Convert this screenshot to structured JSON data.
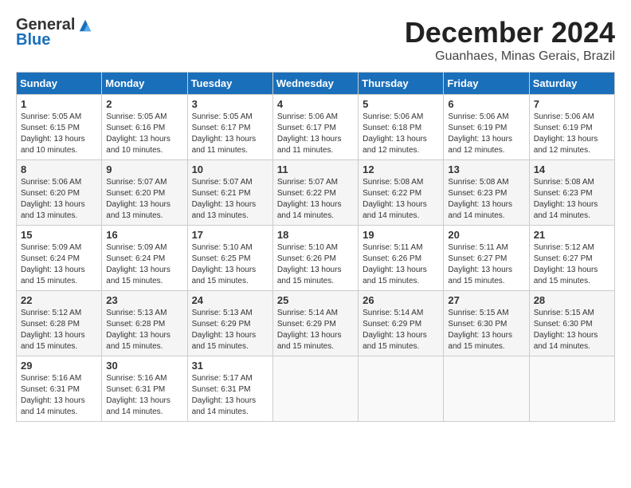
{
  "logo": {
    "general": "General",
    "blue": "Blue"
  },
  "title": "December 2024",
  "subtitle": "Guanhaes, Minas Gerais, Brazil",
  "headers": [
    "Sunday",
    "Monday",
    "Tuesday",
    "Wednesday",
    "Thursday",
    "Friday",
    "Saturday"
  ],
  "weeks": [
    [
      {
        "day": "1",
        "info": "Sunrise: 5:05 AM\nSunset: 6:15 PM\nDaylight: 13 hours\nand 10 minutes."
      },
      {
        "day": "2",
        "info": "Sunrise: 5:05 AM\nSunset: 6:16 PM\nDaylight: 13 hours\nand 10 minutes."
      },
      {
        "day": "3",
        "info": "Sunrise: 5:05 AM\nSunset: 6:17 PM\nDaylight: 13 hours\nand 11 minutes."
      },
      {
        "day": "4",
        "info": "Sunrise: 5:06 AM\nSunset: 6:17 PM\nDaylight: 13 hours\nand 11 minutes."
      },
      {
        "day": "5",
        "info": "Sunrise: 5:06 AM\nSunset: 6:18 PM\nDaylight: 13 hours\nand 12 minutes."
      },
      {
        "day": "6",
        "info": "Sunrise: 5:06 AM\nSunset: 6:19 PM\nDaylight: 13 hours\nand 12 minutes."
      },
      {
        "day": "7",
        "info": "Sunrise: 5:06 AM\nSunset: 6:19 PM\nDaylight: 13 hours\nand 12 minutes."
      }
    ],
    [
      {
        "day": "8",
        "info": "Sunrise: 5:06 AM\nSunset: 6:20 PM\nDaylight: 13 hours\nand 13 minutes."
      },
      {
        "day": "9",
        "info": "Sunrise: 5:07 AM\nSunset: 6:20 PM\nDaylight: 13 hours\nand 13 minutes."
      },
      {
        "day": "10",
        "info": "Sunrise: 5:07 AM\nSunset: 6:21 PM\nDaylight: 13 hours\nand 13 minutes."
      },
      {
        "day": "11",
        "info": "Sunrise: 5:07 AM\nSunset: 6:22 PM\nDaylight: 13 hours\nand 14 minutes."
      },
      {
        "day": "12",
        "info": "Sunrise: 5:08 AM\nSunset: 6:22 PM\nDaylight: 13 hours\nand 14 minutes."
      },
      {
        "day": "13",
        "info": "Sunrise: 5:08 AM\nSunset: 6:23 PM\nDaylight: 13 hours\nand 14 minutes."
      },
      {
        "day": "14",
        "info": "Sunrise: 5:08 AM\nSunset: 6:23 PM\nDaylight: 13 hours\nand 14 minutes."
      }
    ],
    [
      {
        "day": "15",
        "info": "Sunrise: 5:09 AM\nSunset: 6:24 PM\nDaylight: 13 hours\nand 15 minutes."
      },
      {
        "day": "16",
        "info": "Sunrise: 5:09 AM\nSunset: 6:24 PM\nDaylight: 13 hours\nand 15 minutes."
      },
      {
        "day": "17",
        "info": "Sunrise: 5:10 AM\nSunset: 6:25 PM\nDaylight: 13 hours\nand 15 minutes."
      },
      {
        "day": "18",
        "info": "Sunrise: 5:10 AM\nSunset: 6:26 PM\nDaylight: 13 hours\nand 15 minutes."
      },
      {
        "day": "19",
        "info": "Sunrise: 5:11 AM\nSunset: 6:26 PM\nDaylight: 13 hours\nand 15 minutes."
      },
      {
        "day": "20",
        "info": "Sunrise: 5:11 AM\nSunset: 6:27 PM\nDaylight: 13 hours\nand 15 minutes."
      },
      {
        "day": "21",
        "info": "Sunrise: 5:12 AM\nSunset: 6:27 PM\nDaylight: 13 hours\nand 15 minutes."
      }
    ],
    [
      {
        "day": "22",
        "info": "Sunrise: 5:12 AM\nSunset: 6:28 PM\nDaylight: 13 hours\nand 15 minutes."
      },
      {
        "day": "23",
        "info": "Sunrise: 5:13 AM\nSunset: 6:28 PM\nDaylight: 13 hours\nand 15 minutes."
      },
      {
        "day": "24",
        "info": "Sunrise: 5:13 AM\nSunset: 6:29 PM\nDaylight: 13 hours\nand 15 minutes."
      },
      {
        "day": "25",
        "info": "Sunrise: 5:14 AM\nSunset: 6:29 PM\nDaylight: 13 hours\nand 15 minutes."
      },
      {
        "day": "26",
        "info": "Sunrise: 5:14 AM\nSunset: 6:29 PM\nDaylight: 13 hours\nand 15 minutes."
      },
      {
        "day": "27",
        "info": "Sunrise: 5:15 AM\nSunset: 6:30 PM\nDaylight: 13 hours\nand 15 minutes."
      },
      {
        "day": "28",
        "info": "Sunrise: 5:15 AM\nSunset: 6:30 PM\nDaylight: 13 hours\nand 14 minutes."
      }
    ],
    [
      {
        "day": "29",
        "info": "Sunrise: 5:16 AM\nSunset: 6:31 PM\nDaylight: 13 hours\nand 14 minutes."
      },
      {
        "day": "30",
        "info": "Sunrise: 5:16 AM\nSunset: 6:31 PM\nDaylight: 13 hours\nand 14 minutes."
      },
      {
        "day": "31",
        "info": "Sunrise: 5:17 AM\nSunset: 6:31 PM\nDaylight: 13 hours\nand 14 minutes."
      },
      {
        "day": "",
        "info": ""
      },
      {
        "day": "",
        "info": ""
      },
      {
        "day": "",
        "info": ""
      },
      {
        "day": "",
        "info": ""
      }
    ]
  ]
}
